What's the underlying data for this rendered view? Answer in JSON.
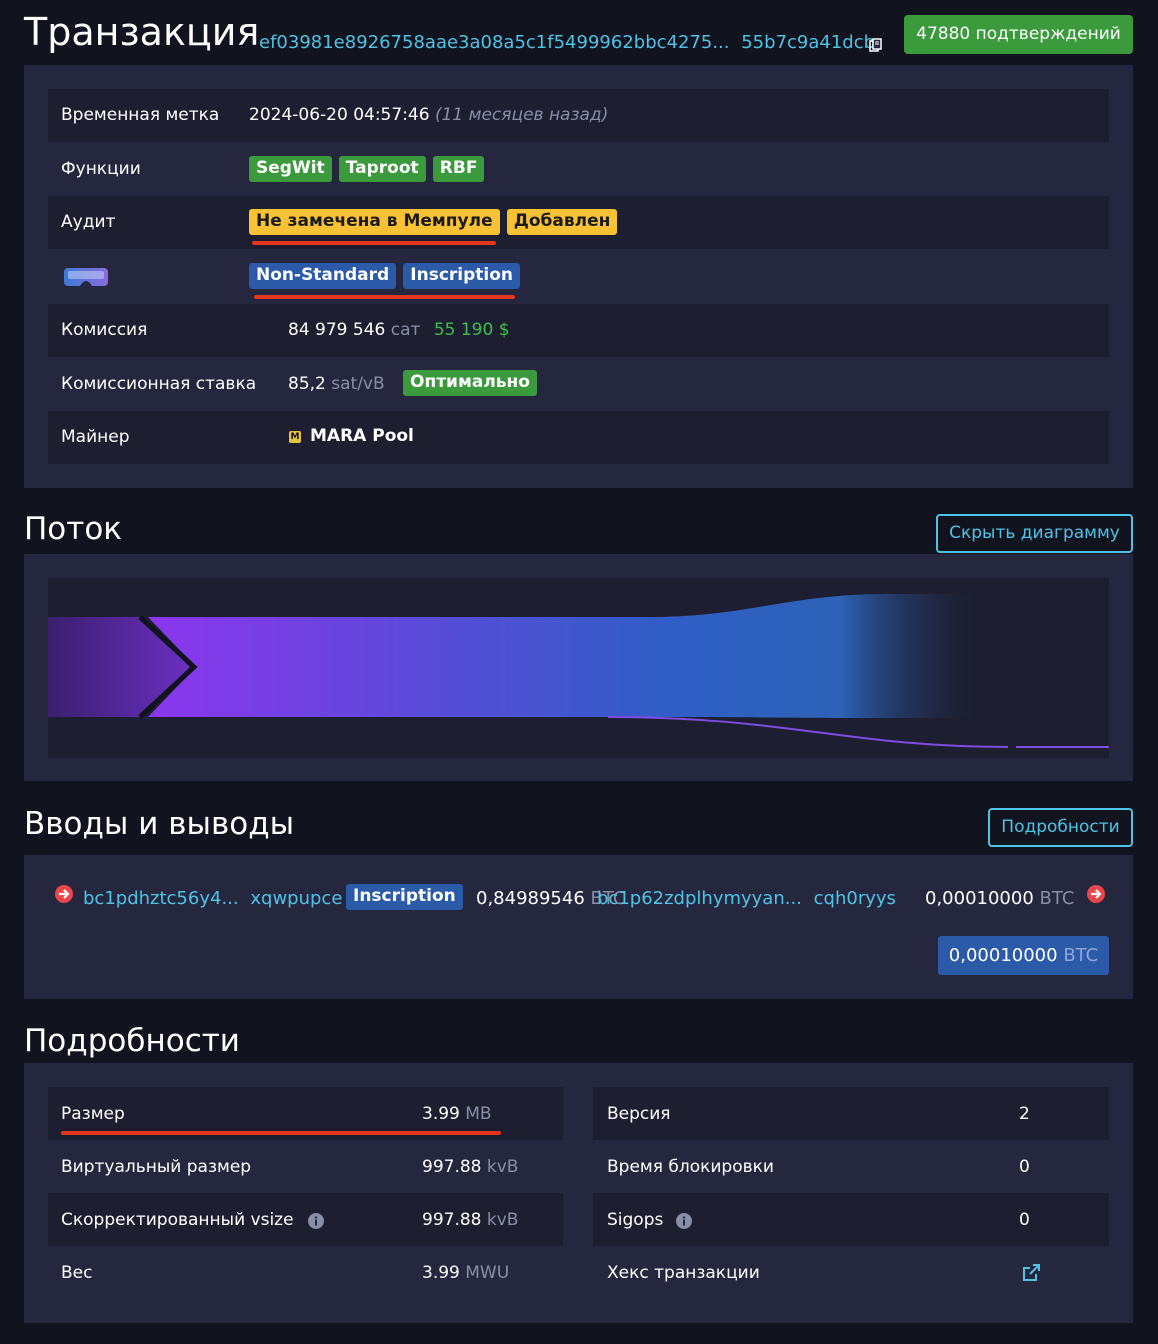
{
  "header": {
    "title": "Транзакция",
    "txid_start": "ef03981e8926758aae3a08a5c1f5499962bbc4275...",
    "txid_end": "55b7c9a41dcb",
    "confirmations": "47880 подтверждений"
  },
  "details_top": {
    "timestamp_label": "Временная метка",
    "timestamp_value": "2024-06-20 04:57:46",
    "timestamp_relative": "(11 месяцев назад)",
    "features_label": "Функции",
    "features": [
      "SegWit",
      "Taproot",
      "RBF"
    ],
    "audit_label": "Аудит",
    "audit_badges": [
      "Не замечена в Мемпуле",
      "Добавлен"
    ],
    "tags": [
      "Non-Standard",
      "Inscription"
    ],
    "fee_label": "Комиссия",
    "fee_value": "84 979 546",
    "fee_unit": "сат",
    "fee_usd": "55 190 $",
    "feerate_label": "Комиссионная ставка",
    "feerate_value": "85,2",
    "feerate_unit": "sat/vB",
    "feerate_badge": "Оптимально",
    "miner_label": "Майнер",
    "miner_logo": "M",
    "miner_value": "MARA Pool"
  },
  "flow": {
    "title": "Поток",
    "hide_button": "Скрыть диаграмму"
  },
  "io": {
    "title": "Вводы и выводы",
    "details_button": "Подробности",
    "input_address_start": "bc1pdhztc56y4...",
    "input_address_end": "xqwpupce",
    "input_tag": "Inscription",
    "input_amount": "0,84989546",
    "input_unit": "BTC",
    "output_address_start": "bc1p62zdplhymyyan...",
    "output_address_end": "cqh0ryys",
    "output_amount": "0,00010000",
    "output_unit": "BTC",
    "total_amount": "0,00010000",
    "total_unit": "BTC"
  },
  "details_bottom": {
    "title": "Подробности",
    "left": [
      {
        "label": "Размер",
        "value": "3.99",
        "unit": "MB"
      },
      {
        "label": "Виртуальный размер",
        "value": "997.88",
        "unit": "kvB"
      },
      {
        "label": "Скорректированный vsize",
        "value": "997.88",
        "unit": "kvB"
      },
      {
        "label": "Вес",
        "value": "3.99",
        "unit": "MWU"
      }
    ],
    "right": [
      {
        "label": "Версия",
        "value": "2"
      },
      {
        "label": "Время блокировки",
        "value": "0"
      },
      {
        "label": "Sigops",
        "value": "0"
      },
      {
        "label": "Хекс транзакции",
        "value": ""
      }
    ]
  },
  "colors": {
    "background": "#11131f",
    "panel": "#24273e",
    "row_dark": "#1d1f31",
    "link": "#4fc3e6",
    "green": "#3a9a3c",
    "yellow": "#f8c234",
    "blue": "#2a5aa8",
    "red_underline": "#e4351e",
    "fee_usd": "#3cbf4a"
  },
  "icons": [
    "copy-icon",
    "accelerator-icon",
    "arrow-right-circle-icon",
    "info-icon",
    "external-link-icon"
  ]
}
